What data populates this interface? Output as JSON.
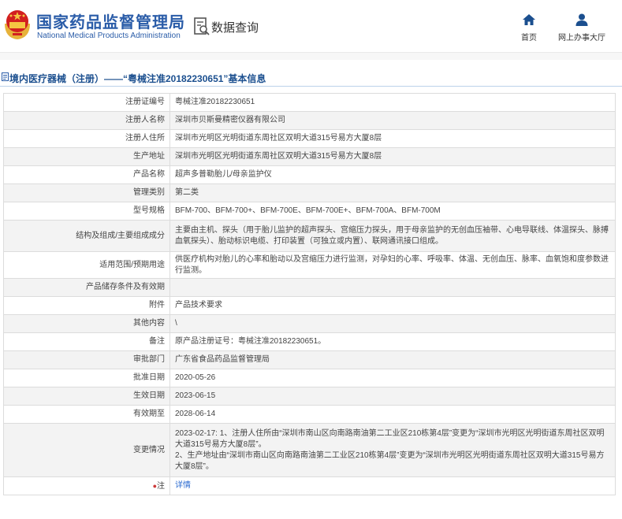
{
  "header": {
    "site_name_cn": "国家药品监督管理局",
    "site_name_en": "National Medical Products Administration",
    "query_label": "数据查询",
    "nav": [
      {
        "label": "首页",
        "icon": "home-icon"
      },
      {
        "label": "网上办事大厅",
        "icon": "user-icon"
      }
    ]
  },
  "page": {
    "title": "境内医疗器械（注册）——“粤械注准20182230651”基本信息"
  },
  "info_rows": [
    {
      "label": "注册证编号",
      "value": "粤械注准20182230651"
    },
    {
      "label": "注册人名称",
      "value": "深圳市贝斯曼精密仪器有限公司"
    },
    {
      "label": "注册人住所",
      "value": "深圳市光明区光明街道东周社区双明大道315号易方大厦8层"
    },
    {
      "label": "生产地址",
      "value": "深圳市光明区光明街道东周社区双明大道315号易方大厦8层"
    },
    {
      "label": "产品名称",
      "value": "超声多普勒胎儿/母亲监护仪"
    },
    {
      "label": "管理类别",
      "value": "第二类"
    },
    {
      "label": "型号规格",
      "value": "BFM-700、BFM-700+、BFM-700E、BFM-700E+、BFM-700A、BFM-700M"
    },
    {
      "label": "结构及组成/主要组成成分",
      "value": "主要由主机、探头（用于胎儿监护的超声探头、宫缩压力探头，用于母亲监护的无创血压袖带、心电导联线、体温探头、脉搏血氧探头）、胎动标识电缆、打印装置（可独立或内置）、联网通讯接口组成。"
    },
    {
      "label": "适用范围/预期用途",
      "value": "供医疗机构对胎儿的心率和胎动以及宫缩压力进行监测，对孕妇的心率、呼吸率、体温、无创血压、脉率、血氧饱和度参数进行监测。"
    },
    {
      "label": "产品储存条件及有效期",
      "value": ""
    },
    {
      "label": "附件",
      "value": "产品技术要求"
    },
    {
      "label": "其他内容",
      "value": "\\"
    },
    {
      "label": "备注",
      "value": "原产品注册证号：粤械注准20182230651。"
    },
    {
      "label": "审批部门",
      "value": "广东省食品药品监督管理局"
    },
    {
      "label": "批准日期",
      "value": "2020-05-26"
    },
    {
      "label": "生效日期",
      "value": "2023-06-15"
    },
    {
      "label": "有效期至",
      "value": "2028-06-14"
    },
    {
      "label": "变更情况",
      "value": "2023-02-17: 1、注册人住所由“深圳市南山区向南路南油第二工业区210栋第4层”变更为“深圳市光明区光明街道东周社区双明大道315号易方大厦8层”。\n2、生产地址由“深圳市南山区向南路南油第二工业区210栋第4层”变更为“深圳市光明区光明街道东周社区双明大道315号易方大厦8层”。"
    }
  ],
  "note_row": {
    "label": "注",
    "link_text": "详情"
  }
}
